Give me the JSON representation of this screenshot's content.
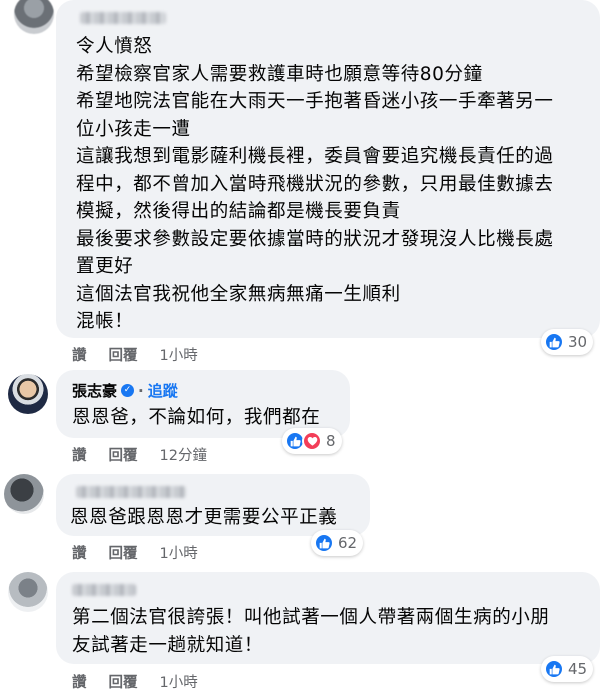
{
  "colors": {
    "bubble": "#f0f2f5",
    "accent": "#1877f2",
    "secondary_text": "#65676b"
  },
  "actions": {
    "like": "讚",
    "reply": "回覆"
  },
  "comments": [
    {
      "author": "",
      "avatar": "blurred-avatar",
      "lines": [
        "令人憤怒",
        "希望檢察官家人需要救護車時也願意等待80分鐘",
        "希望地院法官能在大雨天一手抱著昏迷小孩一手牽著另一",
        "位小孩走一遭",
        "這讓我想到電影薩利機長裡，委員會要追究機長責任的過",
        "程中，都不曾加入當時飛機狀況的參數，只用最佳數據去",
        "模擬，然後得出的結論都是機長要負責",
        "最後要求參數設定要依據當時的狀況才發現沒人比機長處",
        "置更好",
        "這個法官我祝他全家無病無痛一生順利",
        "混帳！"
      ],
      "time": "1小時",
      "reactions": {
        "types": [
          "like"
        ],
        "count": "30"
      }
    },
    {
      "author": "張志豪",
      "verified": true,
      "follow_label": "追蹤",
      "avatar": "profile-photo",
      "lines": [
        "恩恩爸，不論如何，我們都在"
      ],
      "time": "12分鐘",
      "reactions": {
        "types": [
          "like",
          "love"
        ],
        "count": "8"
      }
    },
    {
      "author": "",
      "avatar": "blurred-avatar",
      "lines": [
        "恩恩爸跟恩恩才更需要公平正義"
      ],
      "time": "1小時",
      "reactions": {
        "types": [
          "like"
        ],
        "count": "62"
      }
    },
    {
      "author": "",
      "avatar": "blurred-avatar",
      "lines": [
        "第二個法官很誇張！叫他試著一個人帶著兩個生病的小朋",
        "友試著走一趟就知道！"
      ],
      "time": "1小時",
      "reactions": {
        "types": [
          "like"
        ],
        "count": "45"
      }
    }
  ]
}
